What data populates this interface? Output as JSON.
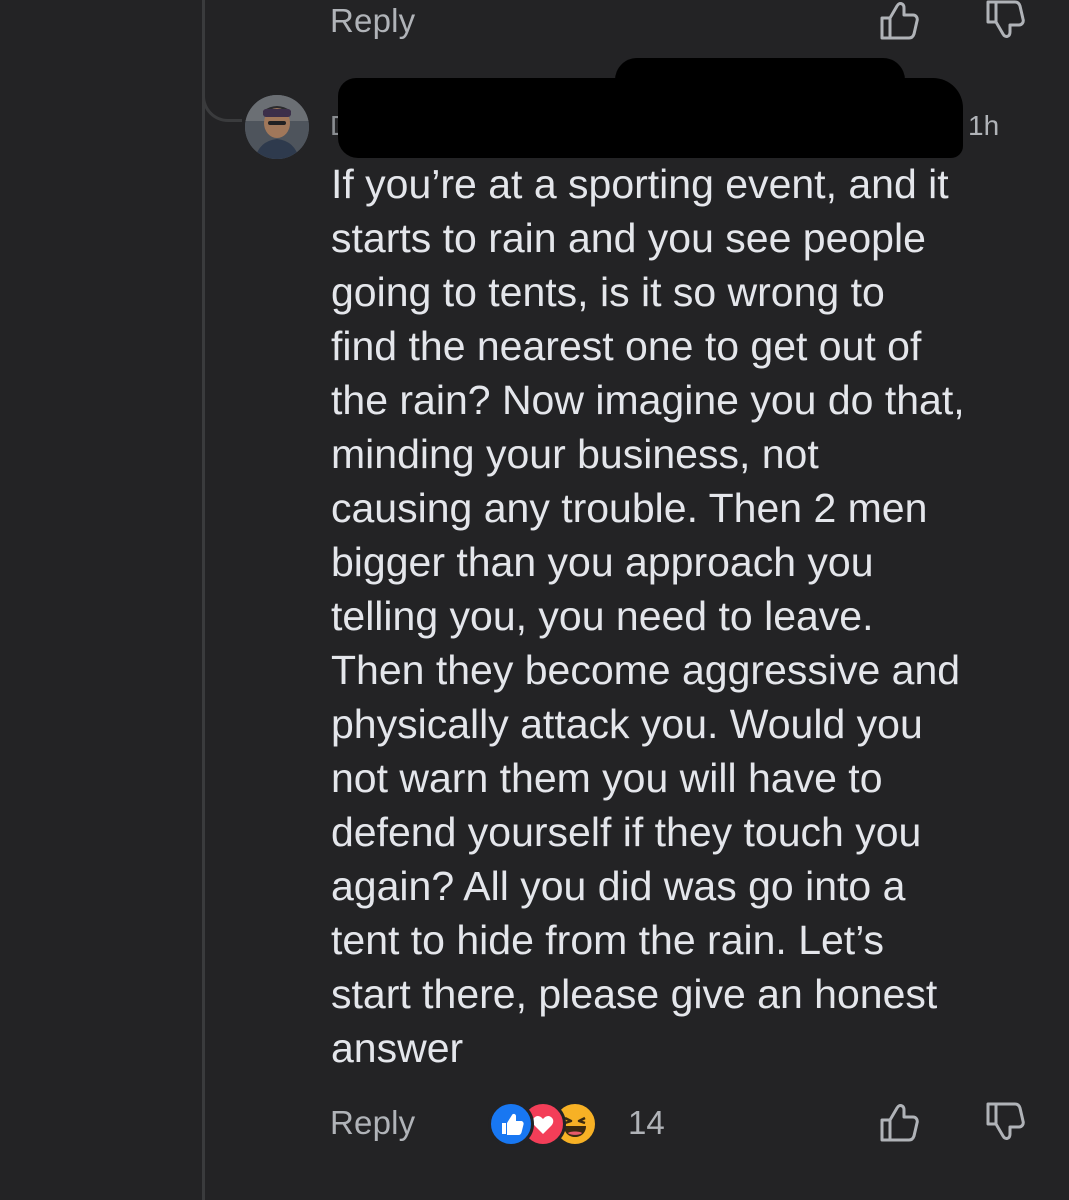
{
  "top_actions": {
    "reply_label": "Reply",
    "icons": [
      "thumbs-up-icon",
      "thumbs-down-icon"
    ]
  },
  "comment": {
    "author_initial": "D",
    "timestamp": "1h",
    "body": "If you’re at a sporting event, and it\nstarts to rain and you see people\ngoing to tents, is it so wrong to\nfind the nearest one to get out of\nthe rain? Now imagine you do that,\nminding your business, not\ncausing any trouble. Then 2 men\nbigger than you approach you\ntelling you, you need to leave.\nThen they become aggressive and\nphysically attack you. Would you\nnot warn them you will have to\ndefend yourself if they touch you\nagain? All you did was go into a\ntent to hide from the rain. Let’s\nstart there, please give an honest\nanswer"
  },
  "bottom_actions": {
    "reply_label": "Reply",
    "reactions": [
      "like-reaction-icon",
      "love-reaction-icon",
      "haha-reaction-icon"
    ],
    "reaction_count": "14"
  },
  "colors": {
    "background": "#232325",
    "text": "#e4e6eb",
    "secondary_text": "#b0b3b8",
    "like": "#1877f2",
    "love": "#f33e58",
    "haha": "#f7b125"
  }
}
